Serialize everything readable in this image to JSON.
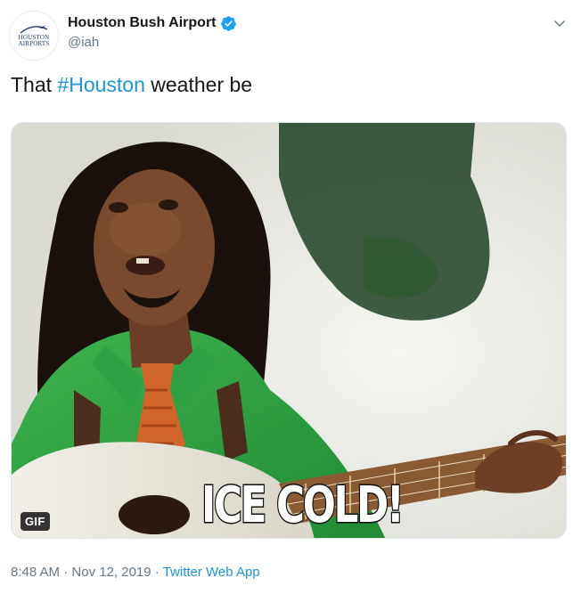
{
  "author": {
    "display_name": "Houston Bush Airport",
    "handle": "@iah",
    "avatar_text_line1": "HOUSTON",
    "avatar_text_line2": "AIRPORTS"
  },
  "tweet": {
    "text_before": "That ",
    "hashtag": "#Houston",
    "text_after": " weather be"
  },
  "media": {
    "caption": "ICE COLD!",
    "badge": "GIF"
  },
  "meta": {
    "time": "8:48 AM",
    "separator1": " · ",
    "date": "Nov 12, 2019",
    "separator2": " · ",
    "source": "Twitter Web App"
  },
  "colors": {
    "link": "#1b95e0",
    "verified": "#1da1f2",
    "muted": "#657786"
  },
  "icons": {
    "verified": "verified-badge-icon",
    "caret": "chevron-down-icon"
  }
}
